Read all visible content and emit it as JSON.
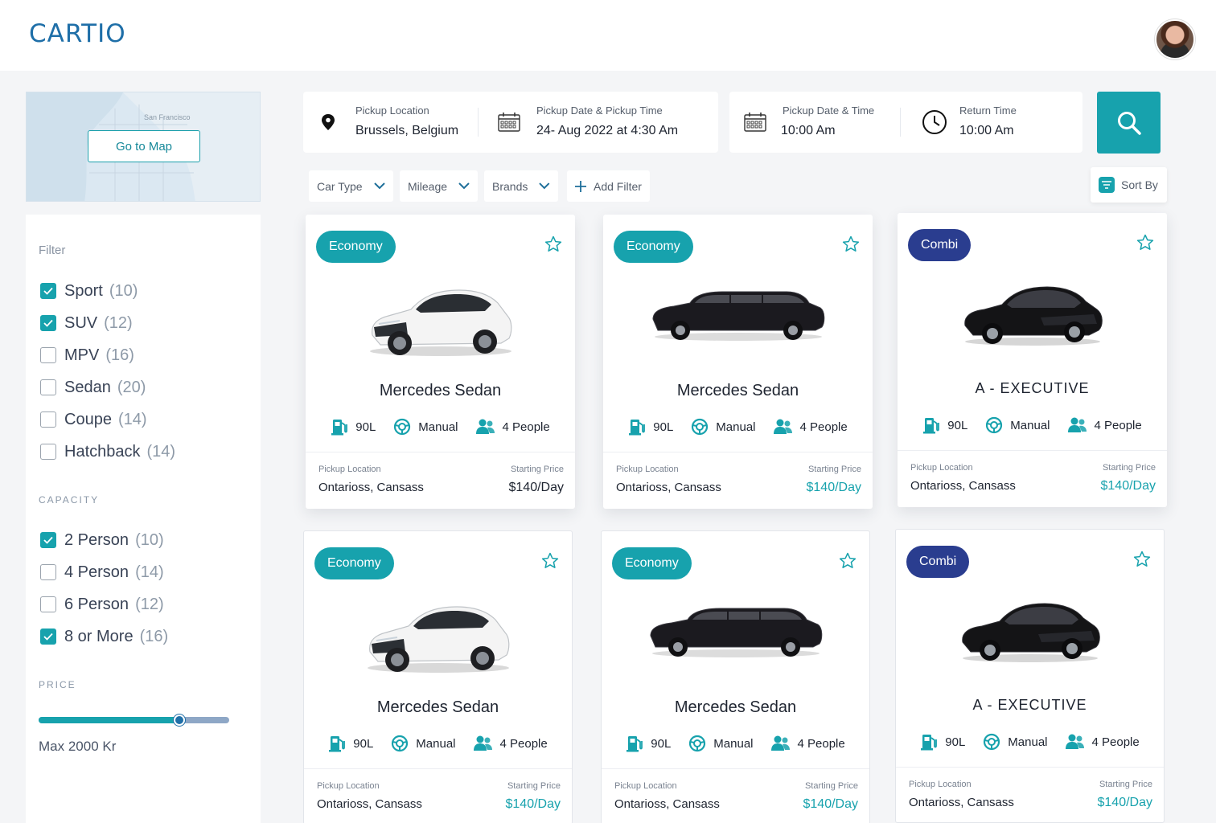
{
  "app": {
    "logo": "CARTIO"
  },
  "map": {
    "button_label": "Go to Map",
    "place_label": "San Francisco"
  },
  "sidebar": {
    "filter_title": "Filter",
    "types": [
      {
        "label": "Sport",
        "count": "(10)",
        "checked": true
      },
      {
        "label": "SUV",
        "count": "(12)",
        "checked": true
      },
      {
        "label": "MPV",
        "count": "(16)",
        "checked": false
      },
      {
        "label": "Sedan",
        "count": "(20)",
        "checked": false
      },
      {
        "label": "Coupe",
        "count": "(14)",
        "checked": false
      },
      {
        "label": "Hatchback",
        "count": "(14)",
        "checked": false
      }
    ],
    "capacity_title": "CAPACITY",
    "capacity": [
      {
        "label": "2 Person",
        "count": "(10)",
        "checked": true
      },
      {
        "label": "4 Person",
        "count": "(14)",
        "checked": false
      },
      {
        "label": "6 Person",
        "count": "(12)",
        "checked": false
      },
      {
        "label": "8 or More",
        "count": "(16)",
        "checked": true
      }
    ],
    "price_title": "PRICE",
    "price_fraction": 0.74,
    "price_max": "Max 2000 Kr"
  },
  "search": {
    "pickup_location_label": "Pickup Location",
    "pickup_location_value": "Brussels, Belgium",
    "pickup_datetime_label": "Pickup Date & Pickup Time",
    "pickup_datetime_value": "24- Aug 2022 at 4:30 Am",
    "pickup_date_time_label": "Pickup Date & Time",
    "pickup_date_time_value": "10:00 Am",
    "return_time_label": "Return Time",
    "return_time_value": "10:00 Am"
  },
  "filters": {
    "car_type": "Car Type",
    "mileage": "Mileage",
    "brands": "Brands",
    "add_filter": "Add Filter",
    "sort_by": "Sort By"
  },
  "colors": {
    "accent": "#17a2ad",
    "navy": "#2a3d8f",
    "brand": "#1f6fa8"
  },
  "cars": [
    {
      "badge": "Economy",
      "badge_color": "teal",
      "name": "Mercedes Sedan",
      "image": "white-hatchback",
      "fuel": "90L",
      "transmission": "Manual",
      "capacity": "4 People",
      "pickup_label": "Pickup Location",
      "pickup": "Ontarioss, Cansass",
      "price_label": "Starting Price",
      "price": "$140/Day"
    },
    {
      "badge": "Economy",
      "badge_color": "teal",
      "name": "Mercedes Sedan",
      "image": "black-limousine",
      "fuel": "90L",
      "transmission": "Manual",
      "capacity": "4 People",
      "pickup_label": "Pickup Location",
      "pickup": "Ontarioss, Cansass",
      "price_label": "Starting Price",
      "price": "$140/Day"
    },
    {
      "badge": "Combi",
      "badge_color": "navy",
      "name": "A - EXECUTIVE",
      "image": "black-sedan",
      "fuel": "90L",
      "transmission": "Manual",
      "capacity": "4 People",
      "pickup_label": "Pickup Location",
      "pickup": "Ontarioss, Cansass",
      "price_label": "Starting Price",
      "price": "$140/Day"
    },
    {
      "badge": "Economy",
      "badge_color": "teal",
      "name": "Mercedes Sedan",
      "image": "white-hatchback",
      "fuel": "90L",
      "transmission": "Manual",
      "capacity": "4 People",
      "pickup_label": "Pickup Location",
      "pickup": "Ontarioss, Cansass",
      "price_label": "Starting Price",
      "price": "$140/Day"
    },
    {
      "badge": "Economy",
      "badge_color": "teal",
      "name": "Mercedes Sedan",
      "image": "black-limousine",
      "fuel": "90L",
      "transmission": "Manual",
      "capacity": "4 People",
      "pickup_label": "Pickup Location",
      "pickup": "Ontarioss, Cansass",
      "price_label": "Starting Price",
      "price": "$140/Day"
    },
    {
      "badge": "Combi",
      "badge_color": "navy",
      "name": "A - EXECUTIVE",
      "image": "black-sedan",
      "fuel": "90L",
      "transmission": "Manual",
      "capacity": "4 People",
      "pickup_label": "Pickup Location",
      "pickup": "Ontarioss, Cansass",
      "price_label": "Starting Price",
      "price": "$140/Day"
    }
  ]
}
